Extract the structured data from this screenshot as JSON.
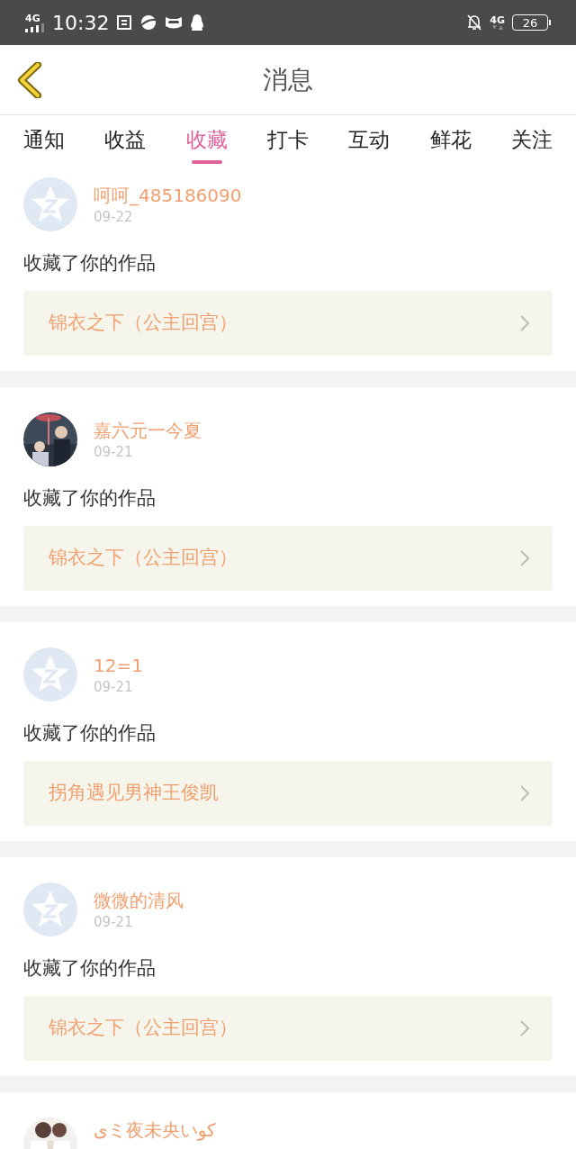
{
  "status_bar": {
    "network_left": "4G",
    "time": "10:32",
    "network_right": "4G",
    "battery": "26"
  },
  "header": {
    "title": "消息"
  },
  "tabs": [
    {
      "label": "通知",
      "selected": false
    },
    {
      "label": "收益",
      "selected": false
    },
    {
      "label": "收藏",
      "selected": true
    },
    {
      "label": "打卡",
      "selected": false
    },
    {
      "label": "互动",
      "selected": false
    },
    {
      "label": "鲜花",
      "selected": false
    },
    {
      "label": "关注",
      "selected": false
    }
  ],
  "messages": [
    {
      "kind": "default",
      "name": "呵呵_485186090",
      "date": "09-22",
      "text": "收藏了你的作品",
      "work": "锦衣之下（公主回宫）"
    },
    {
      "kind": "picture",
      "name": "嘉六元一今夏",
      "date": "09-21",
      "text": "收藏了你的作品",
      "work": "锦衣之下（公主回宫）"
    },
    {
      "kind": "default",
      "name": "12=1",
      "date": "09-21",
      "text": "收藏了你的作品",
      "work": "拐角遇见男神王俊凯"
    },
    {
      "kind": "default",
      "name": "微微的清风",
      "date": "09-21",
      "text": "收藏了你的作品",
      "work": "锦衣之下（公主回宫）"
    },
    {
      "kind": "picture",
      "name": "ىミ夜未央いکو"
    }
  ]
}
